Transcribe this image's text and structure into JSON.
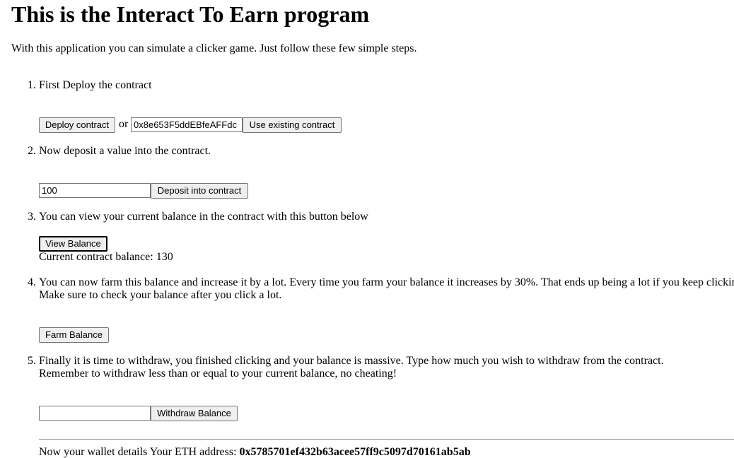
{
  "page": {
    "title": "This is the Interact To Earn program",
    "intro": "With this application you can simulate a clicker game. Just follow these few simple steps."
  },
  "steps": [
    {
      "number": "1.",
      "text": "First Deploy the contract",
      "deploy_button": "Deploy contract",
      "or_text": "or",
      "address_value": "0x8e653F5ddEBfeAFFdc",
      "use_existing_button": "Use existing contract"
    },
    {
      "number": "2.",
      "text": "Now deposit a value into the contract.",
      "deposit_value": "100",
      "deposit_button": "Deposit into contract"
    },
    {
      "number": "3.",
      "text": "You can view your current balance in the contract with this button below",
      "view_button": "View Balance",
      "balance_label": "Current contract balance:",
      "balance_value": "130"
    },
    {
      "number": "4.",
      "line1": "You can now farm this balance and increase it by a lot. Every time you farm your balance it increases by 30%. That ends up being a lot if you keep clicking",
      "line2": "Make sure to check your balance after you click a lot.",
      "farm_button": "Farm Balance"
    },
    {
      "number": "5.",
      "line1": "Finally it is time to withdraw, you finished clicking and your balance is massive. Type how much you wish to withdraw from the contract.",
      "line2": "Remember to withdraw less than or equal to your current balance, no cheating!",
      "withdraw_value": "",
      "withdraw_button": "Withdraw Balance"
    }
  ],
  "wallet": {
    "label": "Now your wallet details Your ETH address:",
    "address": "0x5785701ef432b63acee57ff9c5097d70161ab5ab"
  }
}
